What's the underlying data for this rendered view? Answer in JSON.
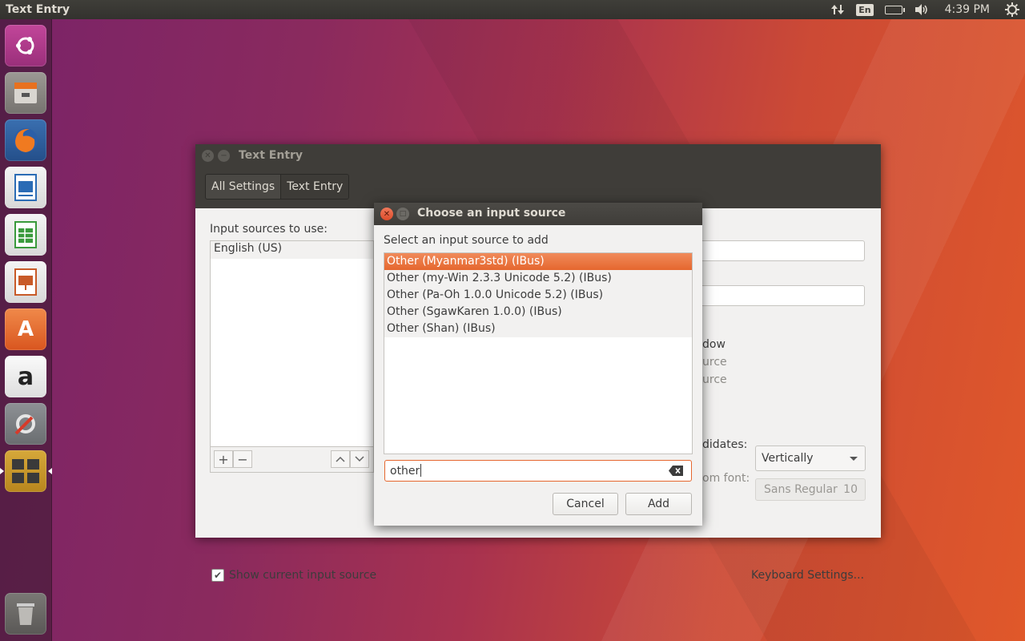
{
  "top_panel": {
    "title": "Text Entry",
    "keyboard_indicator": "En",
    "clock": "4:39 PM"
  },
  "launcher": {
    "items": [
      {
        "name": "dash-home",
        "icon": "ubuntu-logo-icon",
        "color": "#b8388f"
      },
      {
        "name": "files",
        "icon": "file-cabinet-icon",
        "color": "#8a8783"
      },
      {
        "name": "firefox",
        "icon": "firefox-icon",
        "color": "#e8712a"
      },
      {
        "name": "libreoffice-writer",
        "icon": "writer-icon",
        "color": "#2b6cb5"
      },
      {
        "name": "libreoffice-calc",
        "icon": "calc-icon",
        "color": "#3a9a3c"
      },
      {
        "name": "libreoffice-impress",
        "icon": "impress-icon",
        "color": "#c85a28"
      },
      {
        "name": "software-center",
        "icon": "shopping-bag-icon",
        "color": "#e96a2f"
      },
      {
        "name": "amazon",
        "icon": "amazon-icon",
        "color": "#e6e6e6"
      },
      {
        "name": "system-settings",
        "icon": "settings-tools-icon",
        "color": "#7a7d80"
      },
      {
        "name": "workspace-switcher",
        "icon": "workspaces-icon",
        "color": "#c99a28"
      }
    ],
    "trash": {
      "name": "trash",
      "icon": "trash-icon"
    }
  },
  "main_window": {
    "title": "Text Entry",
    "breadcrumb": [
      "All Settings",
      "Text Entry"
    ],
    "sources_label": "Input sources to use:",
    "sources": [
      "English (US)"
    ],
    "partial_labels": {
      "window": "dow",
      "source1": "urce",
      "source2": "urce",
      "candidates": "didates:",
      "custom_font": "om font:"
    },
    "candidates_value": "Vertically",
    "font_name": "Sans Regular",
    "font_size": "10",
    "show_source_label": "Show current input source",
    "show_source_checked": true,
    "keyboard_settings": "Keyboard Settings..."
  },
  "dialog": {
    "title": "Choose an input source",
    "label": "Select an input source to add",
    "items": [
      "Other (Myanmar3std) (IBus)",
      "Other (my-Win 2.3.3 Unicode 5.2) (IBus)",
      "Other (Pa-Oh 1.0.0 Unicode 5.2) (IBus)",
      "Other (SgawKaren 1.0.0) (IBus)",
      "Other (Shan) (IBus)"
    ],
    "selected_index": 0,
    "filter_value": "other",
    "cancel_label": "Cancel",
    "add_label": "Add"
  },
  "colors": {
    "accent": "#e5672f",
    "panel": "#3f3e39",
    "window_bg": "#f2f1f0"
  }
}
